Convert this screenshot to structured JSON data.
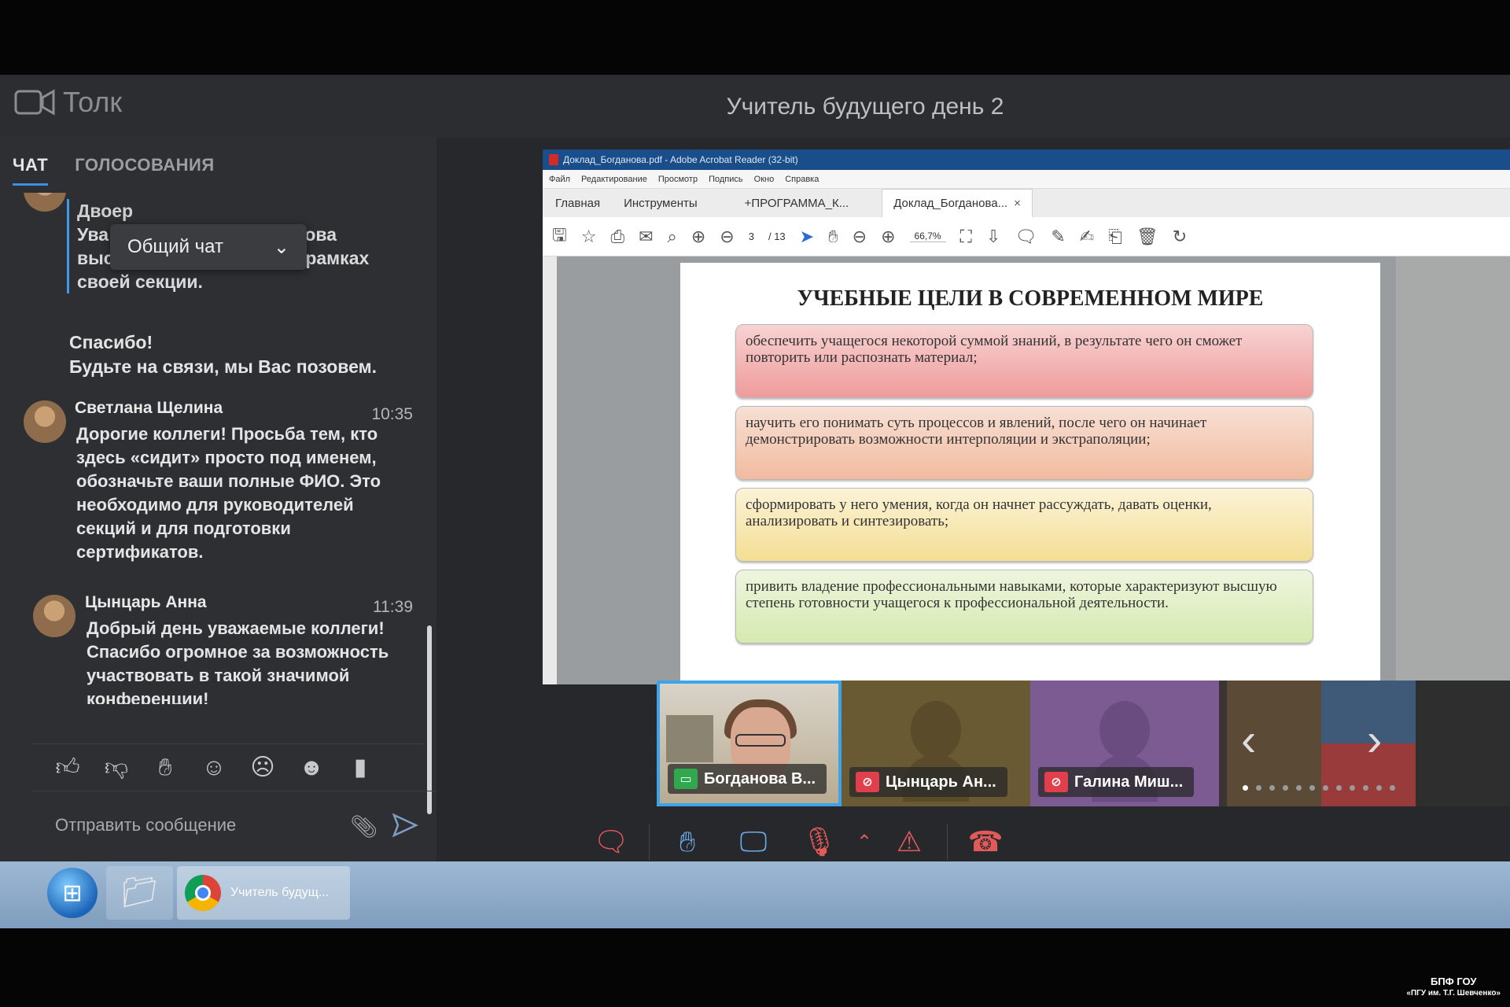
{
  "app": {
    "name": "Толк",
    "title": "Учитель будущего день 2"
  },
  "sidebar": {
    "tabs": [
      {
        "label": "ЧАТ"
      },
      {
        "label": "ГОЛОСОВАНИЯ"
      }
    ],
    "chat_selector": {
      "label": "Общий чат"
    },
    "quote": {
      "author": "Двоер",
      "text_line1": "Ува",
      "text_line1_end": ", готова",
      "text_rest": "выступить с докладом в рамках своей секции."
    },
    "system_reply": {
      "line1": "Спасибо!",
      "line2": "Будьте на связи, мы Вас позовем."
    },
    "messages": [
      {
        "author": "Светлана Щелина",
        "time": "10:35",
        "text": "Дорогие коллеги! Просьба тем, кто здесь «сидит» просто под именем, обозначьте ваши полные ФИО. Это необходимо для руководителей секций и для подготовки сертификатов."
      },
      {
        "author": "Цынцарь Анна",
        "time": "11:39",
        "text": "Добрый день уважаемые коллеги! Спасибо огромное за возможность участвовать в такой значимой конференции!"
      }
    ],
    "reactions": [
      "thumbs-up",
      "thumbs-down",
      "raised-hand",
      "smile",
      "sad",
      "grin",
      "bar"
    ],
    "composer": {
      "placeholder": "Отправить сообщение"
    }
  },
  "pdf": {
    "window_title": "Доклад_Богданова.pdf - Adobe Acrobat Reader (32-bit)",
    "menu": [
      "Файл",
      "Редактирование",
      "Просмотр",
      "Подпись",
      "Окно",
      "Справка"
    ],
    "tabs": [
      "Главная",
      "Инструменты",
      "+ПРОГРАММА_К...",
      "Доклад_Богданова..."
    ],
    "page_current": "3",
    "page_total": "/ 13",
    "zoom": "66,7%",
    "slide": {
      "title": "УЧЕБНЫЕ ЦЕЛИ В СОВРЕМЕННОМ МИРЕ",
      "goals": [
        "обеспечить учащегося некоторой суммой знаний, в результате чего он сможет повторить или распознать материал;",
        "научить его понимать суть процессов и явлений, после чего он начинает демонстрировать возможности интерполяции и экстраполяции;",
        "сформировать у него умения, когда он начнет рассуждать, давать оценки, анализировать и синтезировать;",
        "привить владение профессиональными навыками, которые характеризуют высшую степень готовности учащегося к профессиональной деятельности."
      ]
    }
  },
  "participants": [
    {
      "name": "Богданова В...",
      "status": "screen-sharing"
    },
    {
      "name": "Цынцарь Ан...",
      "status": "muted"
    },
    {
      "name": "Галина Миш...",
      "status": "muted"
    }
  ],
  "controls": [
    "chat-icon",
    "raise-hand-icon",
    "screen-share-icon",
    "mic-off-icon",
    "camera-off-icon",
    "hang-up-icon"
  ],
  "taskbar": {
    "chrome_label": "Учитель будущ..."
  },
  "watermark": {
    "line1": "БПФ ГОУ",
    "line2": "«ПГУ им. Т.Г. Шевченко»"
  }
}
